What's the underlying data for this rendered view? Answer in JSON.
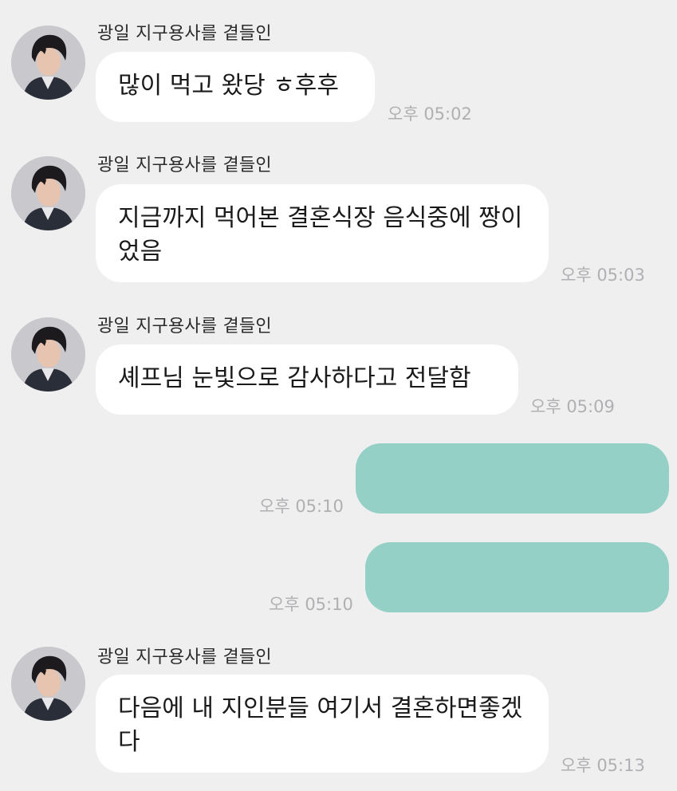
{
  "messages": [
    {
      "type": "in",
      "sender": "광일 지구용사를 곁들인",
      "text": "많이 먹고 왔당 ㅎ후후",
      "time": "오후 05:02"
    },
    {
      "type": "in",
      "sender": "광일 지구용사를 곁들인",
      "text": "지금까지 먹어본 결혼식장 음식중에 짱이었음",
      "time": "오후 05:03"
    },
    {
      "type": "in",
      "sender": "광일 지구용사를 곁들인",
      "text": "셰프님 눈빛으로 감사하다고 전달함",
      "time": "오후 05:09"
    },
    {
      "type": "out",
      "text": "",
      "time": "오후 05:10"
    },
    {
      "type": "out",
      "text": "",
      "time": "오후 05:10"
    },
    {
      "type": "in",
      "sender": "광일 지구용사를 곁들인",
      "text": "다음에 내 지인분들 여기서 결혼하면좋겠다",
      "time": "오후 05:13"
    }
  ],
  "colors": {
    "background": "#efeff0",
    "incoming_bubble": "#ffffff",
    "outgoing_bubble": "#94d0c6",
    "timestamp": "#b0b0b3"
  },
  "icons": {
    "avatar": "profile-photo"
  }
}
